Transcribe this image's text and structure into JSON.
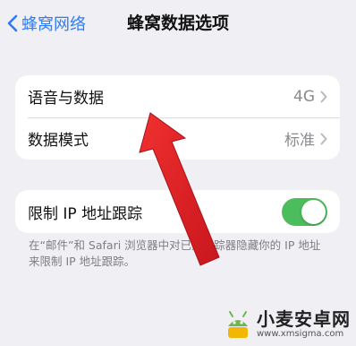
{
  "nav": {
    "back_label": "蜂窝网络",
    "title": "蜂窝数据选项"
  },
  "group1": {
    "rows": [
      {
        "label": "语音与数据",
        "value": "4G"
      },
      {
        "label": "数据模式",
        "value": "标准"
      }
    ]
  },
  "group2": {
    "label": "限制 IP 地址跟踪",
    "toggle_on": true
  },
  "footnote": "在“邮件”和 Safari 浏览器中对已知跟踪器隐藏你的 IP 地址来限制 IP 地址跟踪。",
  "watermark": {
    "brand": "小麦安卓网",
    "url": "www.xmsigma.com"
  },
  "colors": {
    "accent": "#2f7cf6",
    "toggle_on": "#4cbd5d",
    "arrow": "#e3262b"
  }
}
